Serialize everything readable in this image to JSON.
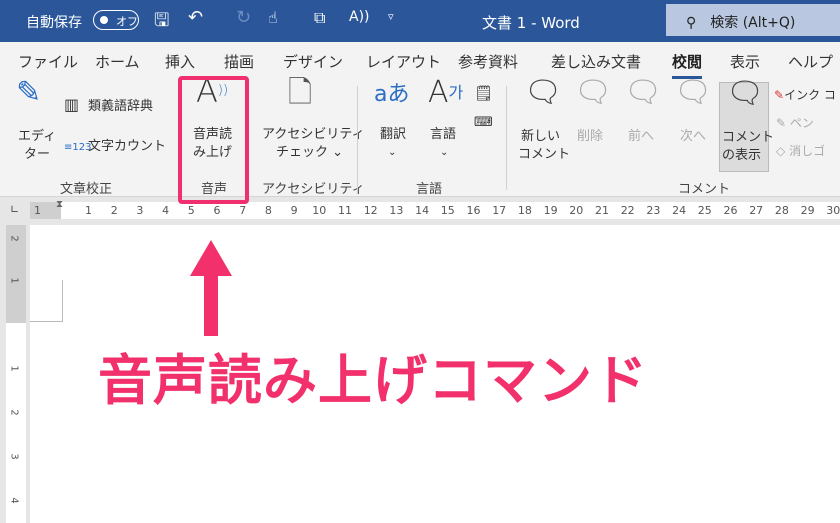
{
  "titlebar": {
    "autosave_label": "自動保存",
    "autosave_state": "オフ",
    "document_title": "文書 1 - Word",
    "search_placeholder": "検索 (Alt+Q)"
  },
  "tabs": [
    "ファイル",
    "ホーム",
    "挿入",
    "描画",
    "デザイン",
    "レイアウト",
    "参考資料",
    "差し込み文書",
    "校閲",
    "表示",
    "ヘルプ"
  ],
  "active_tab": "校閲",
  "ribbon": {
    "editor": "エディ\nター",
    "thesaurus": "類義語辞典",
    "word_count": "文字カウント",
    "group_proofing": "文章校正",
    "read_aloud_1": "音声読",
    "read_aloud_2": "み上げ",
    "group_speech": "音声",
    "accessibility_1": "アクセシビリティ",
    "accessibility_2": "チェック ⌄",
    "group_accessibility": "アクセシビリティ",
    "translate": "翻訳",
    "language": "言語",
    "group_language": "言語",
    "new_comment_1": "新しい",
    "new_comment_2": "コメント",
    "delete": "削除",
    "previous": "前へ",
    "next": "次へ",
    "show_comments_1": "コメント",
    "show_comments_2": "の表示",
    "group_comments": "コメント",
    "ink": "インク コ",
    "pen": "ペン",
    "eraser": "消しゴ"
  },
  "ruler": {
    "numbers": [
      "1",
      "1",
      "2",
      "3",
      "4",
      "5",
      "6",
      "7",
      "8",
      "9",
      "10",
      "11",
      "12",
      "13",
      "14",
      "15",
      "16",
      "17",
      "18",
      "19",
      "20",
      "21",
      "22",
      "23",
      "24",
      "25",
      "26",
      "27",
      "28",
      "29",
      "30"
    ],
    "vertical": [
      "2",
      "1",
      "1",
      "2",
      "3",
      "4"
    ]
  },
  "annotation": {
    "text": "音声読み上げコマンド",
    "color": "#f2306b"
  }
}
